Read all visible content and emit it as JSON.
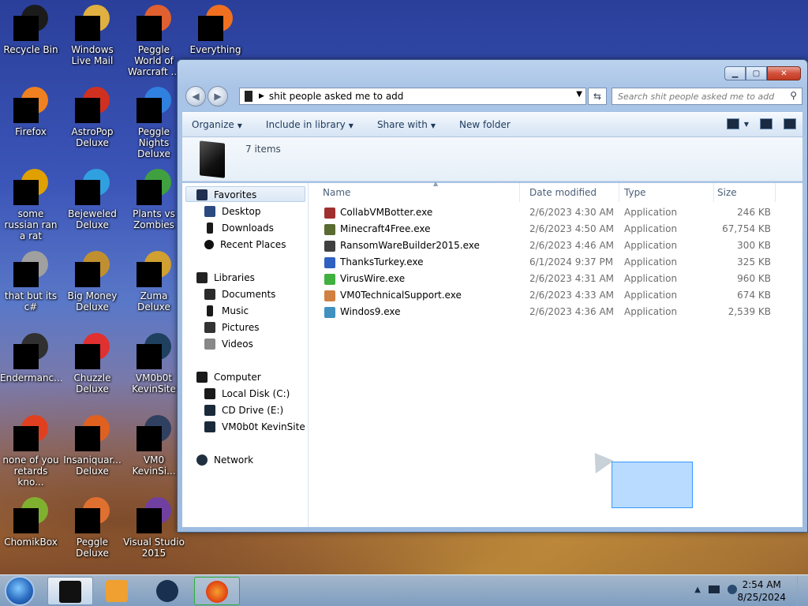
{
  "desktop_icons": [
    {
      "label": "Recycle Bin",
      "color": "#1b1b1b"
    },
    {
      "label": "Windows Live Mail",
      "color": "#e0b040"
    },
    {
      "label": "Peggle World of Warcraft ...",
      "color": "#e06030"
    },
    {
      "label": "Everything",
      "color": "#f07020"
    },
    {
      "label": "Firefox",
      "color": "#f08020"
    },
    {
      "label": "AstroPop Deluxe",
      "color": "#d03020"
    },
    {
      "label": "Peggle Nights Deluxe",
      "color": "#3080e0"
    },
    {
      "label": "some russian ran a rat",
      "color": "#e0a000"
    },
    {
      "label": "Bejeweled Deluxe",
      "color": "#30a0e0"
    },
    {
      "label": "Plants vs Zombies",
      "color": "#40a040"
    },
    {
      "label": "that but its c#",
      "color": "#a0a0a0"
    },
    {
      "label": "Big Money Deluxe",
      "color": "#c09030"
    },
    {
      "label": "Zuma Deluxe",
      "color": "#d0a030"
    },
    {
      "label": "Endermanc...",
      "color": "#303030"
    },
    {
      "label": "Chuzzle Deluxe",
      "color": "#e03030"
    },
    {
      "label": "VM0b0t KevinSite",
      "color": "#204060"
    },
    {
      "label": "none of you retards kno...",
      "color": "#e04020"
    },
    {
      "label": "Insaniquar... Deluxe",
      "color": "#e06020"
    },
    {
      "label": "VM0 KevinSi...",
      "color": "#304060"
    },
    {
      "label": "ChomikBox",
      "color": "#80b030"
    },
    {
      "label": "Peggle Deluxe",
      "color": "#e07030"
    },
    {
      "label": "Visual Studio 2015",
      "color": "#7040a0"
    }
  ],
  "window": {
    "address_path": "shit people asked me to add",
    "search_placeholder": "Search shit people asked me to add",
    "toolbar": {
      "organize": "Organize",
      "include_in_library": "Include in library",
      "share_with": "Share with",
      "new_folder": "New folder"
    },
    "items_count": "7 items",
    "nav": {
      "favorites": "Favorites",
      "desktop": "Desktop",
      "downloads": "Downloads",
      "recent_places": "Recent Places",
      "libraries": "Libraries",
      "documents": "Documents",
      "music": "Music",
      "pictures": "Pictures",
      "videos": "Videos",
      "computer": "Computer",
      "local_disk": "Local Disk (C:)",
      "cd_drive": "CD Drive (E:)",
      "vm0b0t_site": "VM0b0t KevinSite",
      "network": "Network"
    },
    "columns": {
      "name": "Name",
      "date_modified": "Date modified",
      "type": "Type",
      "size": "Size"
    },
    "files": [
      {
        "name": "CollabVMBotter.exe",
        "date": "2/6/2023 4:30 AM",
        "type": "Application",
        "size": "246 KB",
        "icon_color": "#a03030"
      },
      {
        "name": "Minecraft4Free.exe",
        "date": "2/6/2023 4:50 AM",
        "type": "Application",
        "size": "67,754 KB",
        "icon_color": "#5a6a30"
      },
      {
        "name": "RansomWareBuilder2015.exe",
        "date": "2/6/2023 4:46 AM",
        "type": "Application",
        "size": "300 KB",
        "icon_color": "#404040"
      },
      {
        "name": "ThanksTurkey.exe",
        "date": "6/1/2024 9:37 PM",
        "type": "Application",
        "size": "325 KB",
        "icon_color": "#3060c0"
      },
      {
        "name": "VirusWire.exe",
        "date": "2/6/2023 4:31 AM",
        "type": "Application",
        "size": "960 KB",
        "icon_color": "#40b040"
      },
      {
        "name": "VM0TechnicalSupport.exe",
        "date": "2/6/2023 4:33 AM",
        "type": "Application",
        "size": "674 KB",
        "icon_color": "#d08040"
      },
      {
        "name": "Windos9.exe",
        "date": "2/6/2023 4:36 AM",
        "type": "Application",
        "size": "2,539 KB",
        "icon_color": "#4090c0"
      }
    ]
  },
  "taskbar": {
    "time": "2:54 AM",
    "date": "8/25/2024"
  }
}
